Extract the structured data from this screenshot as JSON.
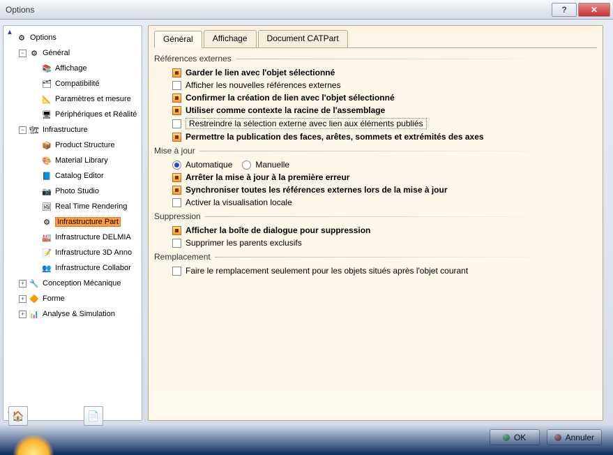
{
  "window": {
    "title": "Options"
  },
  "tree": {
    "root": "Options",
    "items": [
      {
        "label": "Général",
        "level": 1,
        "icon": "⚙"
      },
      {
        "label": "Affichage",
        "level": 2,
        "icon": "📚"
      },
      {
        "label": "Compatibilité",
        "level": 2,
        "icon": "🗂"
      },
      {
        "label": "Paramètres et mesure",
        "level": 2,
        "icon": "📐"
      },
      {
        "label": "Périphériques et Réalité",
        "level": 2,
        "icon": "🖥"
      },
      {
        "label": "Infrastructure",
        "level": 1,
        "icon": "🏗"
      },
      {
        "label": "Product Structure",
        "level": 2,
        "icon": "📦"
      },
      {
        "label": "Material Library",
        "level": 2,
        "icon": "🎨"
      },
      {
        "label": "Catalog Editor",
        "level": 2,
        "icon": "📘"
      },
      {
        "label": "Photo Studio",
        "level": 2,
        "icon": "📷"
      },
      {
        "label": "Real Time Rendering",
        "level": 2,
        "icon": "🖼"
      },
      {
        "label": "Infrastructure Part",
        "level": 2,
        "icon": "⚙",
        "selected": true
      },
      {
        "label": "Infrastructure DELMIA",
        "level": 2,
        "icon": "🏭"
      },
      {
        "label": "Infrastructure 3D Anno",
        "level": 2,
        "icon": "📝"
      },
      {
        "label": "Infrastructure Collabor",
        "level": 2,
        "icon": "👥"
      },
      {
        "label": "Conception Mécanique",
        "level": 1,
        "icon": "🔧"
      },
      {
        "label": "Forme",
        "level": 1,
        "icon": "🔶"
      },
      {
        "label": "Analyse & Simulation",
        "level": 1,
        "icon": "📊"
      }
    ]
  },
  "tabs": [
    {
      "label": "Général",
      "active": true
    },
    {
      "label": "Affichage",
      "active": false
    },
    {
      "label": "Document CATPart",
      "active": false
    }
  ],
  "groups": {
    "ref_ext": {
      "title": "Références externes",
      "opts": [
        {
          "label": "Garder le lien avec l'objet sélectionné",
          "checked": true,
          "bold": true
        },
        {
          "label": "Afficher les nouvelles références externes",
          "checked": false,
          "bold": false
        },
        {
          "label": "Confirmer la création de lien avec l'objet sélectionné",
          "checked": true,
          "bold": true
        },
        {
          "label": "Utiliser comme contexte la racine de l'assemblage",
          "checked": true,
          "bold": true
        },
        {
          "label": "Restreindre la sélection externe avec lien aux éléments publiés",
          "checked": false,
          "bold": false,
          "highlight": true
        },
        {
          "label": "Permettre la publication des faces, arêtes, sommets et extrémités des axes",
          "checked": true,
          "bold": true
        }
      ]
    },
    "maj": {
      "title": "Mise à jour",
      "radio": {
        "auto": "Automatique",
        "manual": "Manuelle",
        "value": "auto"
      },
      "opts": [
        {
          "label": "Arrêter la mise à jour à la première erreur",
          "checked": true,
          "bold": true
        },
        {
          "label": "Synchroniser toutes les références externes lors de la mise à jour",
          "checked": true,
          "bold": true
        },
        {
          "label": "Activer la visualisation locale",
          "checked": false,
          "bold": false
        }
      ]
    },
    "supp": {
      "title": "Suppression",
      "opts": [
        {
          "label": "Afficher la boîte de dialogue pour suppression",
          "checked": true,
          "bold": true
        },
        {
          "label": "Supprimer les parents exclusifs",
          "checked": false,
          "bold": false
        }
      ]
    },
    "repl": {
      "title": "Remplacement",
      "opts": [
        {
          "label": "Faire le remplacement seulement pour les objets situés après l'objet courant",
          "checked": false,
          "bold": false
        }
      ]
    }
  },
  "buttons": {
    "ok": "OK",
    "cancel": "Annuler"
  }
}
